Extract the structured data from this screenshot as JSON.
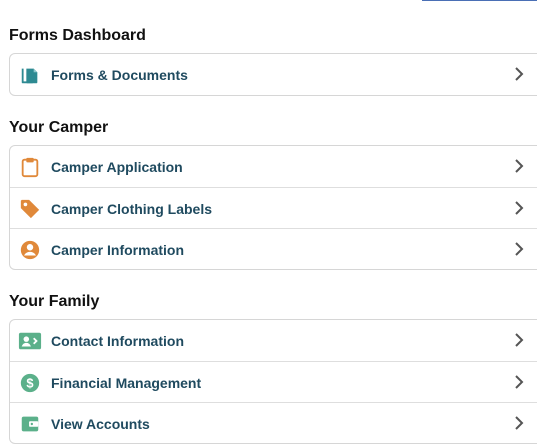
{
  "sections": [
    {
      "title": "Forms Dashboard",
      "items": [
        {
          "label": "Forms & Documents",
          "icon": "documents-icon",
          "color": "#2e8a92"
        }
      ]
    },
    {
      "title": "Your Camper",
      "items": [
        {
          "label": "Camper Application",
          "icon": "clipboard-icon",
          "color": "#e0893a"
        },
        {
          "label": "Camper Clothing Labels",
          "icon": "tag-icon",
          "color": "#e0893a"
        },
        {
          "label": "Camper Information",
          "icon": "user-circle-icon",
          "color": "#e0893a"
        }
      ]
    },
    {
      "title": "Your Family",
      "items": [
        {
          "label": "Contact Information",
          "icon": "contact-card-icon",
          "color": "#5bb08a"
        },
        {
          "label": "Financial Management",
          "icon": "dollar-circle-icon",
          "color": "#5bb08a"
        },
        {
          "label": "View Accounts",
          "icon": "wallet-icon",
          "color": "#5bb08a"
        }
      ]
    }
  ],
  "chevron_icon": "chevron-right-icon"
}
